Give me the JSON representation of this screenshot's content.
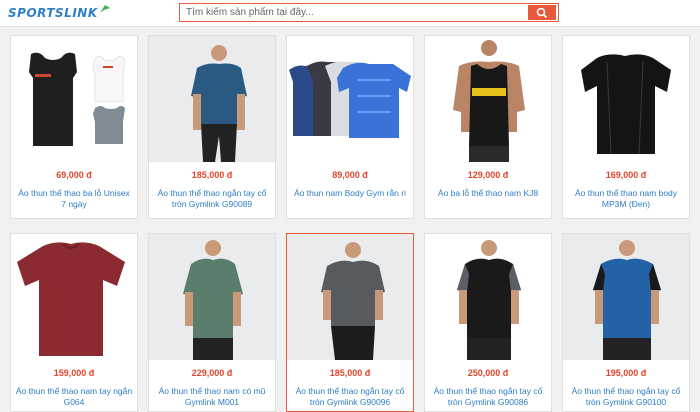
{
  "header": {
    "logo_text": "SPORTSLINK",
    "search_placeholder": "Tìm kiếm sản phẩm tại đây...",
    "search_icon": "search-icon",
    "accent_color": "#e8583b",
    "link_color": "#2e7dc4"
  },
  "products": [
    {
      "price": "69,000 đ",
      "name": "Áo thun thể thao ba lỗ Unisex 7 ngày",
      "image": "three sleeveless tank tops (black, white, grey)"
    },
    {
      "price": "185,000 đ",
      "name": "Áo thun thể thao ngắn tay cổ tròn Gymlink G90089",
      "image": "man in navy t-shirt"
    },
    {
      "price": "89,000 đ",
      "name": "Áo thun nam Body Gym rằn ri",
      "image": "stack of camo compression shirts"
    },
    {
      "price": "129,000 đ",
      "name": "Áo ba lỗ thể thao nam KJ8",
      "image": "man in black ANIMAL tank top"
    },
    {
      "price": "169,000 đ",
      "name": "Áo thun thể thao nam body MP3M (Đen)",
      "image": "black compression t-shirt"
    },
    {
      "price": "159,000 đ",
      "name": "Áo thun thể thao nam tay ngắn G064",
      "image": "maroon t-shirt"
    },
    {
      "price": "229,000 đ",
      "name": "Áo thun thể thao nam có mũ Gymlink M001",
      "image": "man in green hooded t-shirt"
    },
    {
      "price": "185,000 đ",
      "name": "Áo thun thể thao ngắn tay cổ tròn Gymlink G90096",
      "image": "man in grey t-shirt"
    },
    {
      "price": "250,000 đ",
      "name": "Áo thun thể thao ngắn tay cổ tròn Gymlink G90086",
      "image": "man in black camo-sleeve t-shirt"
    },
    {
      "price": "195,000 đ",
      "name": "Áo thun thể thao ngắn tay cổ tròn Gymlink G90100",
      "image": "man in blue and black t-shirt"
    }
  ]
}
